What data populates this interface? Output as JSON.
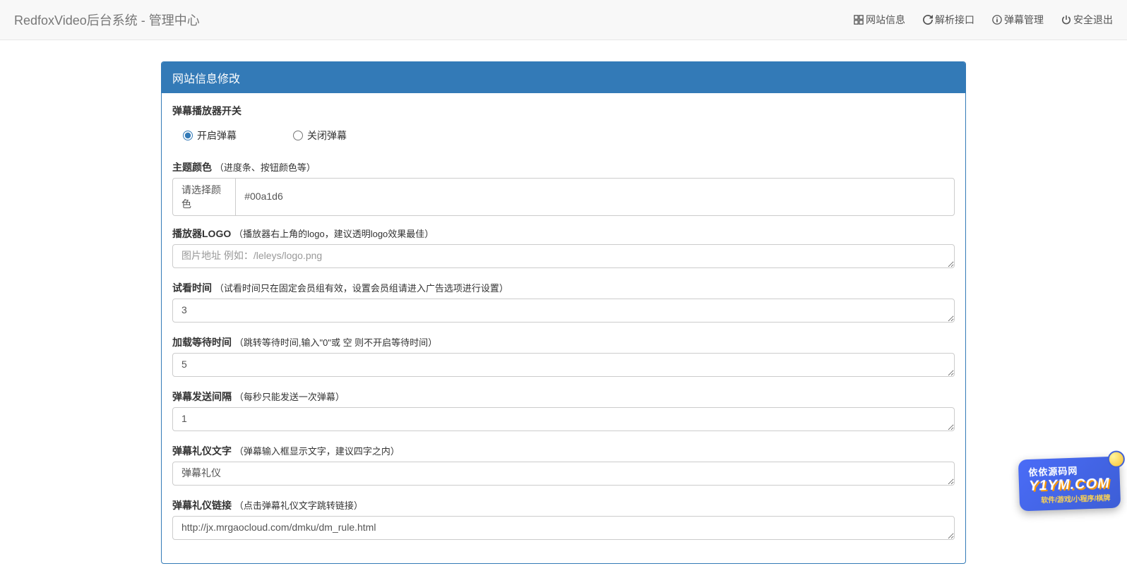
{
  "header": {
    "title": "RedfoxVideo后台系统 - 管理中心",
    "nav": [
      {
        "label": "网站信息",
        "icon": "grid"
      },
      {
        "label": "解析接口",
        "icon": "refresh"
      },
      {
        "label": "弹幕管理",
        "icon": "info"
      },
      {
        "label": "安全退出",
        "icon": "power"
      }
    ]
  },
  "panel": {
    "title": "网站信息修改"
  },
  "form": {
    "danmu_switch": {
      "label": "弹幕播放器开关",
      "option_on": "开启弹幕",
      "option_off": "关闭弹幕",
      "value": "on"
    },
    "theme_color": {
      "label": "主题颜色",
      "hint": "（进度条、按钮颜色等）",
      "addon": "请选择颜色",
      "value": "#00a1d6"
    },
    "player_logo": {
      "label": "播放器LOGO",
      "hint": "（播放器右上角的logo，建议透明logo效果最佳）",
      "placeholder": "图片地址 例如：/leleys/logo.png",
      "value": ""
    },
    "preview_time": {
      "label": "试看时间",
      "hint": "（试看时间只在固定会员组有效，设置会员组请进入广告选项进行设置）",
      "value": "3"
    },
    "loading_wait": {
      "label": "加载等待时间",
      "hint": "（跳转等待时间,输入\"0\"或 空 则不开启等待时间）",
      "value": "5"
    },
    "danmu_interval": {
      "label": "弹幕发送间隔",
      "hint": "（每秒只能发送一次弹幕）",
      "value": "1"
    },
    "danmu_etiquette_text": {
      "label": "弹幕礼仪文字",
      "hint": "（弹幕输入框显示文字，建议四字之内）",
      "value": "弹幕礼仪"
    },
    "danmu_etiquette_link": {
      "label": "弹幕礼仪链接",
      "hint": "（点击弹幕礼仪文字跳转链接）",
      "value": "http://jx.mrgaocloud.com/dmku/dm_rule.html"
    }
  },
  "watermark": {
    "top": "依依源码网",
    "main": "Y1YM.COM",
    "sub": "软件/游戏/小程序/棋牌"
  }
}
